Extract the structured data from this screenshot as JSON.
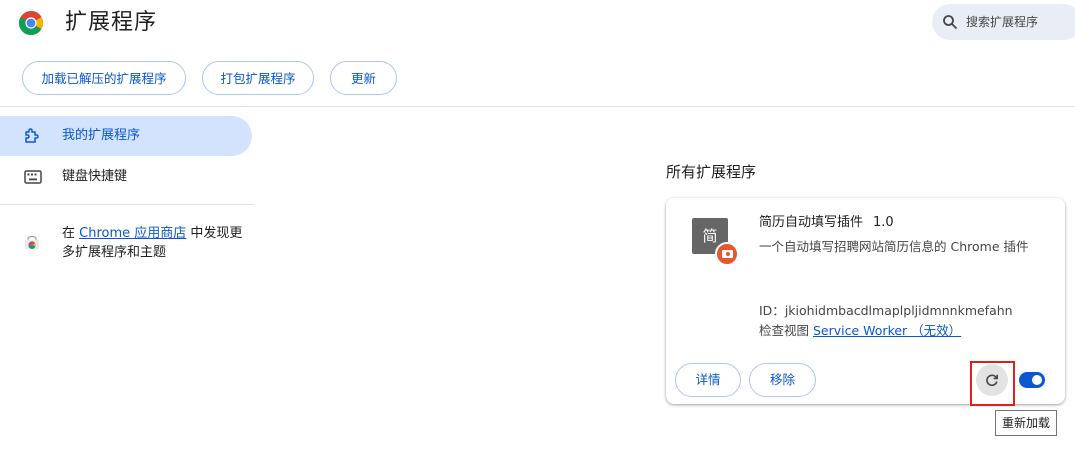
{
  "header": {
    "title": "扩展程序",
    "search_placeholder": "搜索扩展程序"
  },
  "toolbar": {
    "load_unpacked": "加载已解压的扩展程序",
    "pack": "打包扩展程序",
    "update": "更新"
  },
  "sidebar": {
    "items": [
      {
        "label": "我的扩展程序",
        "icon": "puzzle-icon",
        "selected": true
      },
      {
        "label": "键盘快捷键",
        "icon": "keyboard-icon",
        "selected": false
      }
    ],
    "store_prefix": "在 ",
    "store_link": "Chrome 应用商店",
    "store_suffix": " 中发现更多扩展程序和主题"
  },
  "main": {
    "section_title": "所有扩展程序",
    "extension": {
      "icon_text": "简",
      "name": "简历自动填写插件",
      "version": "1.0",
      "description": "一个自动填写招聘网站简历信息的 Chrome 插件",
      "id_label": "ID：",
      "id": "jkiohidmbacdlmaplpljidmnnkmefahn",
      "inspect_label": "检查视图 ",
      "inspect_link": "Service Worker （无效）",
      "details_label": "详情",
      "remove_label": "移除",
      "enabled": true
    }
  },
  "tooltip": "重新加载",
  "colors": {
    "accent": "#0b57d0",
    "selected_bg": "#d3e3fd",
    "highlight": "#e02020",
    "badge": "#e8562d"
  }
}
